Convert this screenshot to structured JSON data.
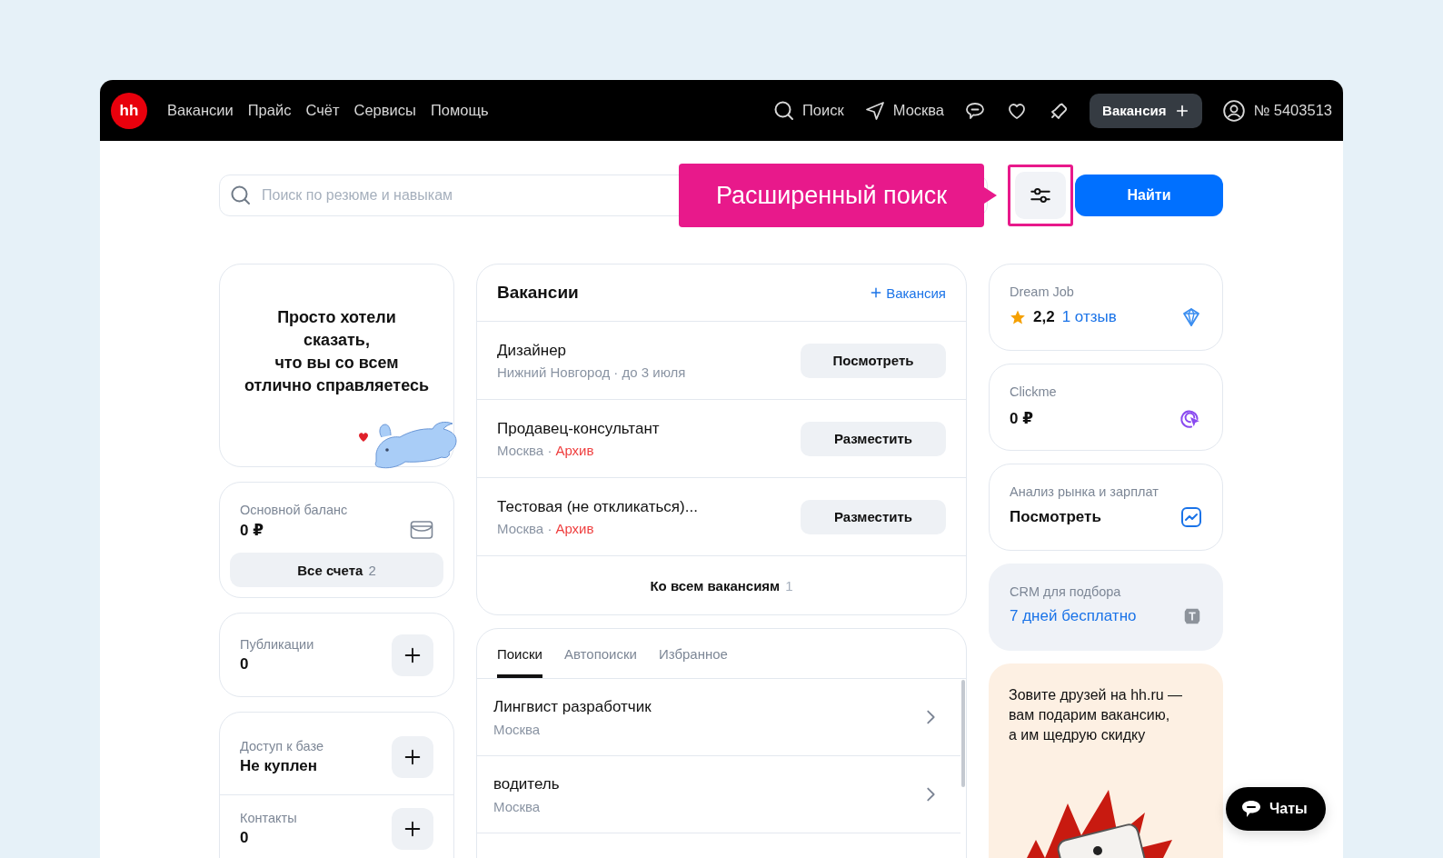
{
  "header": {
    "logo": "hh",
    "nav": [
      "Вакансии",
      "Прайс",
      "Счёт",
      "Сервисы",
      "Помощь"
    ],
    "search": "Поиск",
    "city": "Москва",
    "create_button": "Вакансия",
    "account": "№ 5403513"
  },
  "search_bar": {
    "placeholder": "Поиск по резюме и навыкам",
    "callout": "Расширенный поиск",
    "submit": "Найти"
  },
  "promo": {
    "text": "Просто хотели\nсказать,\nчто вы со всем\nотлично справляетесь"
  },
  "balance": {
    "label": "Основной баланс",
    "value": "0 ₽",
    "accounts_button": "Все счета",
    "accounts_count": "2"
  },
  "publications": {
    "label": "Публикации",
    "value": "0"
  },
  "database_card": [
    {
      "label": "Доступ к базе",
      "value": "Не куплен"
    },
    {
      "label": "Контакты",
      "value": "0"
    }
  ],
  "vacancies": {
    "title": "Вакансии",
    "add_link": "Вакансия",
    "items": [
      {
        "title": "Дизайнер",
        "subtitle": "Нижний Новгород · до 3 июля",
        "action": "Посмотреть"
      },
      {
        "title": "Продавец-консультант",
        "subtitle": "Москва ·",
        "status": "Архив",
        "action": "Разместить"
      },
      {
        "title": "Тестовая (не откликаться)...",
        "subtitle": "Москва ·",
        "status": "Архив",
        "action": "Разместить"
      }
    ],
    "all_link": "Ко всем вакансиям",
    "all_count": "1"
  },
  "searches": {
    "tabs": [
      {
        "label": "Поиски",
        "selected": true
      },
      {
        "label": "Автопоиски",
        "selected": false
      },
      {
        "label": "Избранное",
        "selected": false
      }
    ],
    "items": [
      {
        "title": "Лингвист разработчик",
        "subtitle": "Москва"
      },
      {
        "title": "водитель",
        "subtitle": "Москва"
      }
    ]
  },
  "services": [
    {
      "kind": "rating",
      "label": "Dream Job",
      "rating": "2,2",
      "link": "1 отзыв"
    },
    {
      "kind": "value",
      "label": "Clickme",
      "value": "0 ₽"
    },
    {
      "kind": "value",
      "label": "Анализ рынка и зарплат",
      "value": "Посмотреть"
    },
    {
      "kind": "link",
      "label": "CRM для подбора",
      "link": "7 дней бесплатно"
    }
  ],
  "referral": {
    "text": "Зовите друзей на hh.ru —\nвам подарим вакансию,\nа им щедрую скидку"
  },
  "chat_button": "Чаты"
}
